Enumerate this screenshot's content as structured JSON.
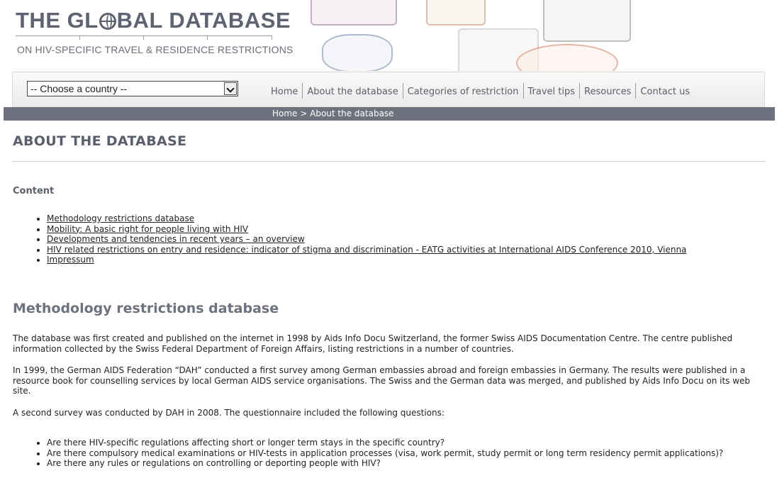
{
  "logo": {
    "title_before": "THE GL",
    "title_after": "BAL DATABASE",
    "subtitle": "ON HIV-SPECIFIC TRAVEL & RESIDENCE RESTRICTIONS"
  },
  "country_select": {
    "selected": "-- Choose a country --"
  },
  "nav": {
    "items": [
      "Home",
      "About the database",
      "Categories of restriction",
      "Travel tips",
      "Resources",
      "Contact us"
    ]
  },
  "breadcrumb": {
    "home": "Home",
    "separator": " > ",
    "current": "About the database"
  },
  "page": {
    "title": "ABOUT THE DATABASE",
    "content_label": "Content",
    "toc": [
      "Methodology restrictions database",
      "Mobility: A basic right for people living with HIV",
      "Developments and tendencies in recent years – an overview",
      "HIV related restrictions on entry and residence: indicator of stigma and discrimination - EATG activities at International AIDS Conference 2010, Vienna",
      "Impressum"
    ],
    "section_title": "Methodology restrictions database",
    "paragraphs": [
      "The database was first created and published on the internet in 1998 by Aids Info Docu Switzerland, the former Swiss AIDS Documentation Centre. The centre published information collected by the Swiss Federal Department of Foreign Affairs, listing restrictions in a number of countries.",
      "In 1999, the German AIDS Federation “DAH” conducted a first survey among German embassies abroad and foreign embassies in Germany. The results were published in a resource book for counselling services by local German AIDS service organisations. The Swiss and the German data was merged, and published by Aids Info Docu on its web site.",
      "A second survey was conducted by DAH in 2008. The questionnaire included the following questions:"
    ],
    "questions": [
      "Are there HIV-specific regulations affecting short or longer term stays in the specific country?",
      "Are there compulsory medical examinations or HIV-tests in application processes (visa, work permit, study permit or long term residency permit applications)?",
      "Are there any rules or regulations on controlling or deporting people with HIV?"
    ]
  },
  "colors": {
    "brand_gray": "#5b5e6b",
    "crumb_bar": "#6e717e"
  }
}
